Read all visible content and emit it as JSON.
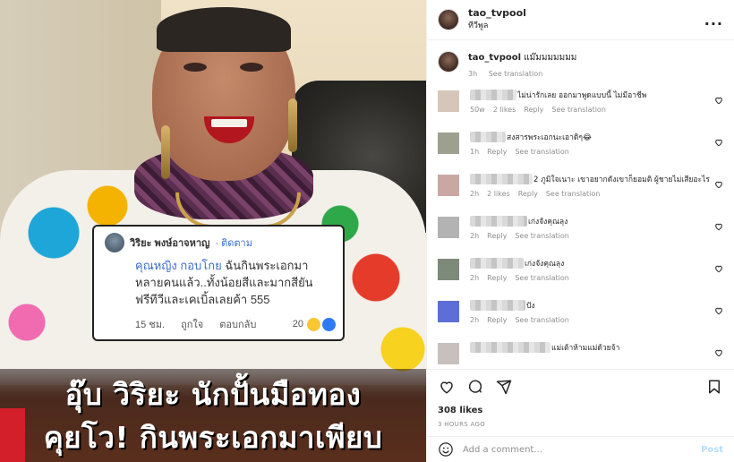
{
  "post": {
    "username": "tao_tvpool",
    "subtitle": "ทีวีพูล",
    "more": "...",
    "caption": {
      "username": "tao_tvpool",
      "text": "แม๊มมมมมมม",
      "time": "3h",
      "see_translation": "See translation"
    }
  },
  "image": {
    "card": {
      "name": "วิริยะ พงษ์อาจหาญ",
      "follow": "· ติดตาม",
      "tag": "คุณหญิง กอบโกย",
      "text_line1": " ฉันกินพระเอกมา",
      "text_line2": "หลายคนแล้ว..ทั้งน้อยสีและมากสียัน",
      "text_line3": "ฟรีทีวีและเคเบิ้ลเลยค้า 555",
      "time": "15 ชม.",
      "like": "ถูกใจ",
      "reply": "ตอบกลับ",
      "count": "20"
    },
    "headline1": "อุ๊บ วิริยะ นักปั้นมือทอง",
    "headline2": "คุยโว! กินพระเอกมาเพียบ"
  },
  "comments": [
    {
      "text": "ไม่น่ารักเลย ออกมาพูดแบบนี้ ไม่มีอาชีพ",
      "time": "50w",
      "likes": "2 likes",
      "reply": "Reply",
      "see_translation": "See translation",
      "avatar_color": "#d6c6b9"
    },
    {
      "text": "สงสารพระเอกนะเอาดิๆ😂",
      "time": "1h",
      "likes": "",
      "reply": "Reply",
      "see_translation": "See translation",
      "avatar_color": "#9da08f"
    },
    {
      "text": "2 ภูมิใจเนาะ เขาอยากดังเขาก็ยอมติ ผู้ชายไม่เสียอะไร",
      "time": "2h",
      "likes": "2 likes",
      "reply": "Reply",
      "see_translation": "See translation",
      "avatar_color": "#caa7a3"
    },
    {
      "text": "เก่งจังคุณลุง",
      "time": "2h",
      "likes": "",
      "reply": "Reply",
      "see_translation": "See translation",
      "avatar_color": "#b3b3b3"
    },
    {
      "text": "เก่งจังคุณลุง",
      "time": "2h",
      "likes": "",
      "reply": "Reply",
      "see_translation": "See translation",
      "avatar_color": "#7d8a79"
    },
    {
      "text": "ปัง",
      "time": "2h",
      "likes": "",
      "reply": "Reply",
      "see_translation": "See translation",
      "avatar_color": "#5d6fd6"
    },
    {
      "text": "แม่เต้าห้ามแม่ด้วยจ้า",
      "time": "",
      "likes": "",
      "reply": "",
      "see_translation": "",
      "avatar_color": "#c8c0bd"
    }
  ],
  "footer": {
    "likes": "308 likes",
    "date": "3 HOURS AGO",
    "add_comment_placeholder": "Add a comment...",
    "post_label": "Post"
  }
}
